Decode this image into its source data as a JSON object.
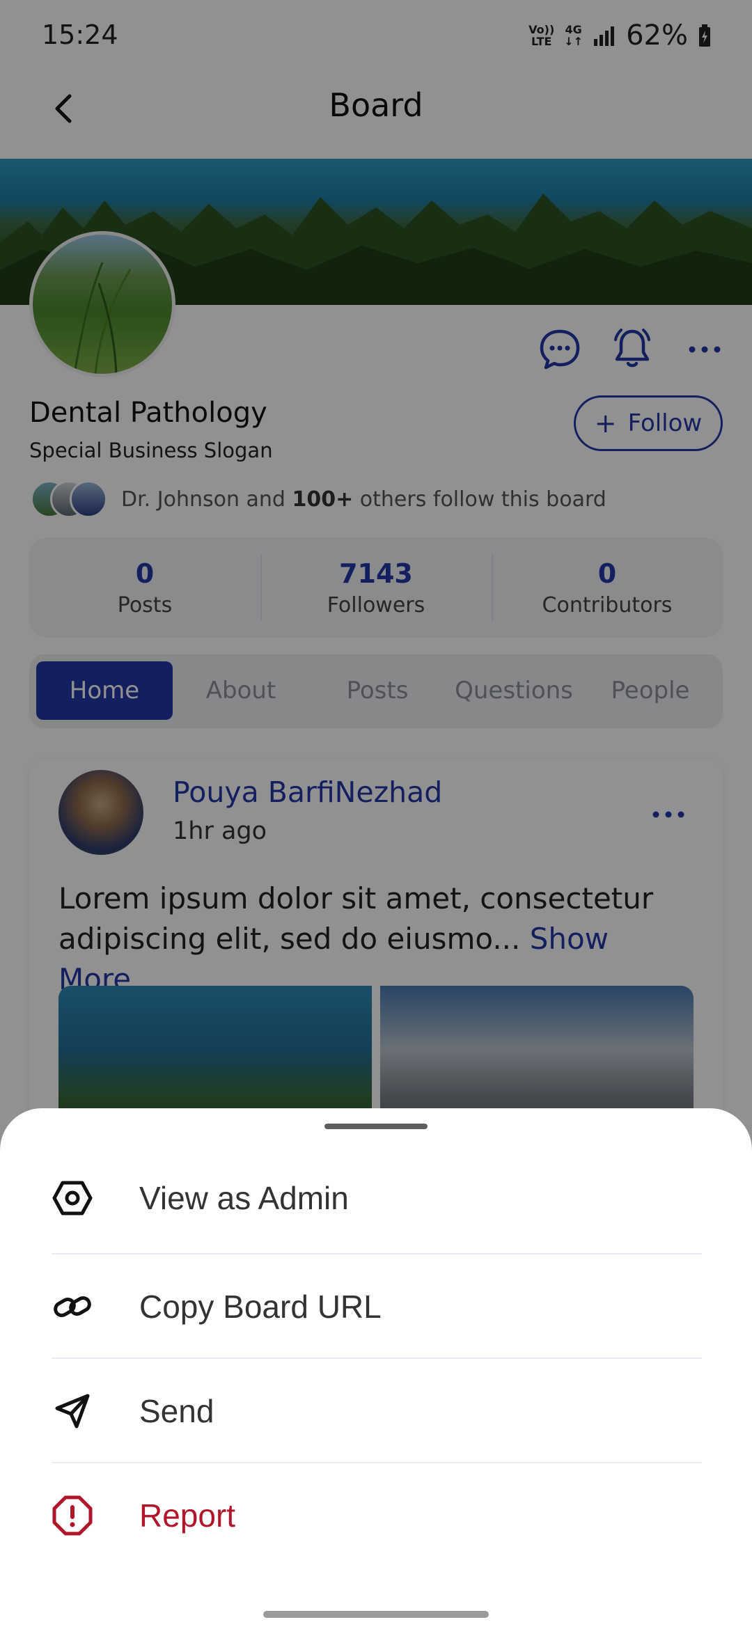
{
  "status_bar": {
    "time": "15:24",
    "network_lte": "Vo)) LTE",
    "network_4g": "4G",
    "battery": "62%"
  },
  "header": {
    "title": "Board"
  },
  "board": {
    "name": "Dental Pathology",
    "slogan": "Special Business Slogan",
    "follow_label": "Follow",
    "followers_text_prefix": "Dr. Johnson and ",
    "followers_text_bold": "100+",
    "followers_text_suffix": " others follow this board"
  },
  "stats": [
    {
      "value": "0",
      "label": "Posts"
    },
    {
      "value": "7143",
      "label": "Followers"
    },
    {
      "value": "0",
      "label": "Contributors"
    }
  ],
  "tabs": [
    {
      "label": "Home",
      "active": true
    },
    {
      "label": "About"
    },
    {
      "label": "Posts"
    },
    {
      "label": "Questions"
    },
    {
      "label": "People"
    }
  ],
  "post": {
    "author": "Pouya BarfiNezhad",
    "time": "1hr ago",
    "text": "Lorem ipsum dolor sit amet, consectetur adipiscing elit, sed do eiusmo... ",
    "show_more": "Show More"
  },
  "sheet": {
    "items": [
      {
        "label": "View as Admin",
        "icon": "hexagon-settings-icon"
      },
      {
        "label": "Copy Board URL",
        "icon": "link-icon"
      },
      {
        "label": "Send",
        "icon": "send-icon"
      },
      {
        "label": "Report",
        "icon": "report-icon"
      }
    ]
  },
  "colors": {
    "accent": "#2337a8",
    "danger": "#b0152a",
    "overlay": "rgba(0,0,0,0.43)"
  }
}
